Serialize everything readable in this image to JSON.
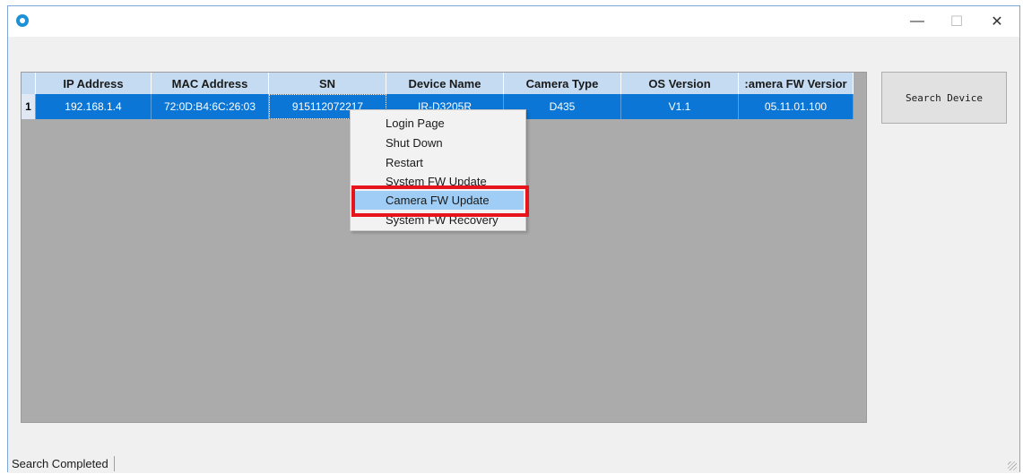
{
  "window": {
    "icon": "app-logo-icon",
    "controls": {
      "minimize": "—",
      "maximize": "☐",
      "close": "✕"
    }
  },
  "table": {
    "columns": [
      "IP Address",
      "MAC Address",
      "SN",
      "Device Name",
      "Camera Type",
      "OS Version",
      ":amera FW Versior"
    ],
    "rows": [
      {
        "index": "1",
        "cells": [
          "192.168.1.4",
          "72:0D:B4:6C:26:03",
          "915112072217",
          "IR-D3205R",
          "D435",
          "V1.1",
          "05.11.01.100"
        ]
      }
    ]
  },
  "search_button": {
    "label": "Search Device"
  },
  "context_menu": {
    "items": [
      "Login Page",
      "Shut Down",
      "Restart",
      "System FW Update",
      "Camera FW Update",
      "System FW Recovery"
    ],
    "highlighted": "Camera FW Update",
    "highlight_color": "#e8141c"
  },
  "status": {
    "text": "Search Completed"
  },
  "colors": {
    "selection": "#0b76d6",
    "header": "#c4dbf1",
    "menu_hover": "#9fcdf5"
  }
}
